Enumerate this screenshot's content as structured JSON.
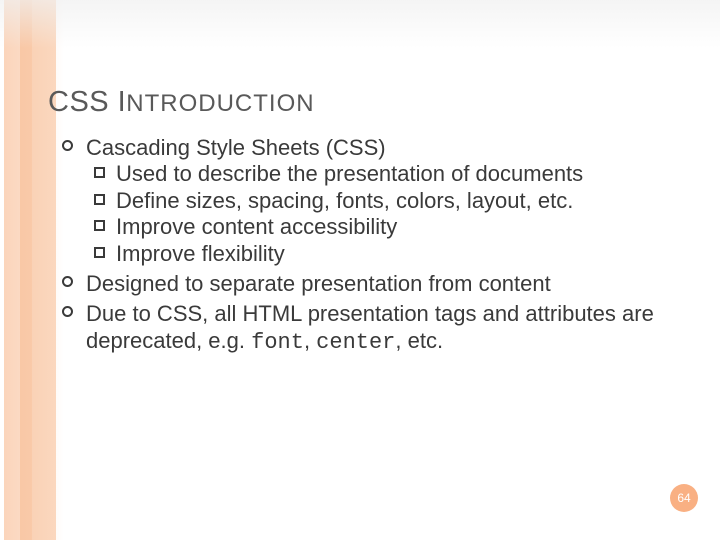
{
  "title_main": "CSS I",
  "title_smallcaps": "NTRODUCTION",
  "bullets": {
    "b1": "Cascading Style Sheets (CSS)",
    "b1_1": "Used to describe the presentation of documents",
    "b1_2": "Define sizes, spacing, fonts, colors, layout, etc.",
    "b1_3": "Improve content accessibility",
    "b1_4": "Improve flexibility",
    "b2": "Designed to separate presentation from content",
    "b3_pre": "Due to CSS, all HTML presentation tags and attributes are deprecated, e.g. ",
    "b3_mono1": "font",
    "b3_mid": ", ",
    "b3_mono2": "center",
    "b3_post": ", etc."
  },
  "page_number": "64"
}
